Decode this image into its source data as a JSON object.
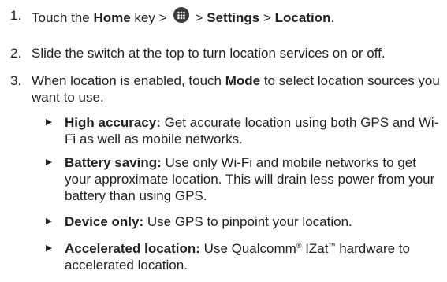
{
  "steps": [
    {
      "number": "1.",
      "text_a": "Touch the ",
      "bold_a": "Home",
      "text_b": " key >",
      "icon": "apps-grid-icon",
      "text_c": "> ",
      "bold_b": "Settings",
      "text_d": " > ",
      "bold_c": "Location",
      "text_e": "."
    },
    {
      "number": "2.",
      "text": "Slide the switch at the top to turn location services on or off."
    },
    {
      "number": "3.",
      "text_a": "When location is enabled, touch ",
      "bold": "Mode",
      "text_b": " to select location sources you want to use."
    }
  ],
  "bullets": [
    {
      "title": "High accuracy:",
      "text": " Get accurate location using both GPS and Wi-Fi as well as mobile networks."
    },
    {
      "title": "Battery saving:",
      "text": " Use only Wi-Fi and mobile networks to get your approximate location. This will drain less power from your battery than using GPS."
    },
    {
      "title": "Device only:",
      "text": " Use GPS to pinpoint your location."
    },
    {
      "title": "Accelerated location:",
      "text_a": " Use Qualcomm",
      "mark_a": "®",
      "text_b": " IZat",
      "mark_b": "™",
      "text_c": " hardware to accelerated location."
    }
  ]
}
